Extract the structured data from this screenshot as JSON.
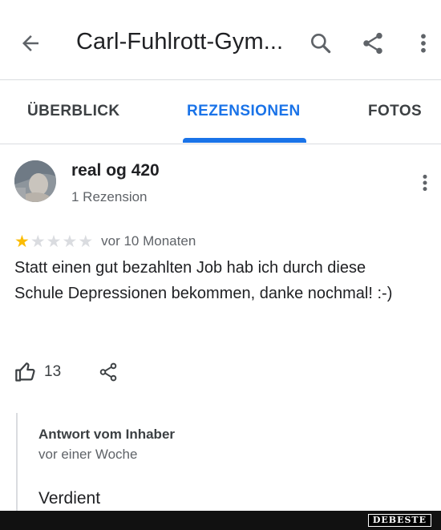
{
  "header": {
    "title": "Carl-Fuhlrott-Gym...",
    "back_icon": "arrow-back-icon",
    "search_icon": "search-icon",
    "share_icon": "share-icon",
    "more_icon": "more-vert-icon"
  },
  "tabs": [
    {
      "label": "ÜBERBLICK",
      "active": false
    },
    {
      "label": "REZENSIONEN",
      "active": true
    },
    {
      "label": "FOTOS",
      "active": false
    }
  ],
  "review": {
    "reviewer_name": "real og 420",
    "reviewer_meta": "1 Rezension",
    "rating": 1,
    "rating_max": 5,
    "date": "vor 10 Monaten",
    "text": "Statt einen gut bezahlten Job hab ich durch diese Schule Depressionen bekommen, danke nochmal! :-)",
    "likes": "13"
  },
  "owner_reply": {
    "title": "Antwort vom Inhaber",
    "date": "vor einer Woche",
    "text": "Verdient"
  },
  "watermark": "DEBESTE",
  "colors": {
    "accent": "#1a73e8",
    "star_filled": "#fbbc04",
    "star_empty": "#dadce0",
    "text_primary": "#202124",
    "text_secondary": "#5f6368"
  }
}
